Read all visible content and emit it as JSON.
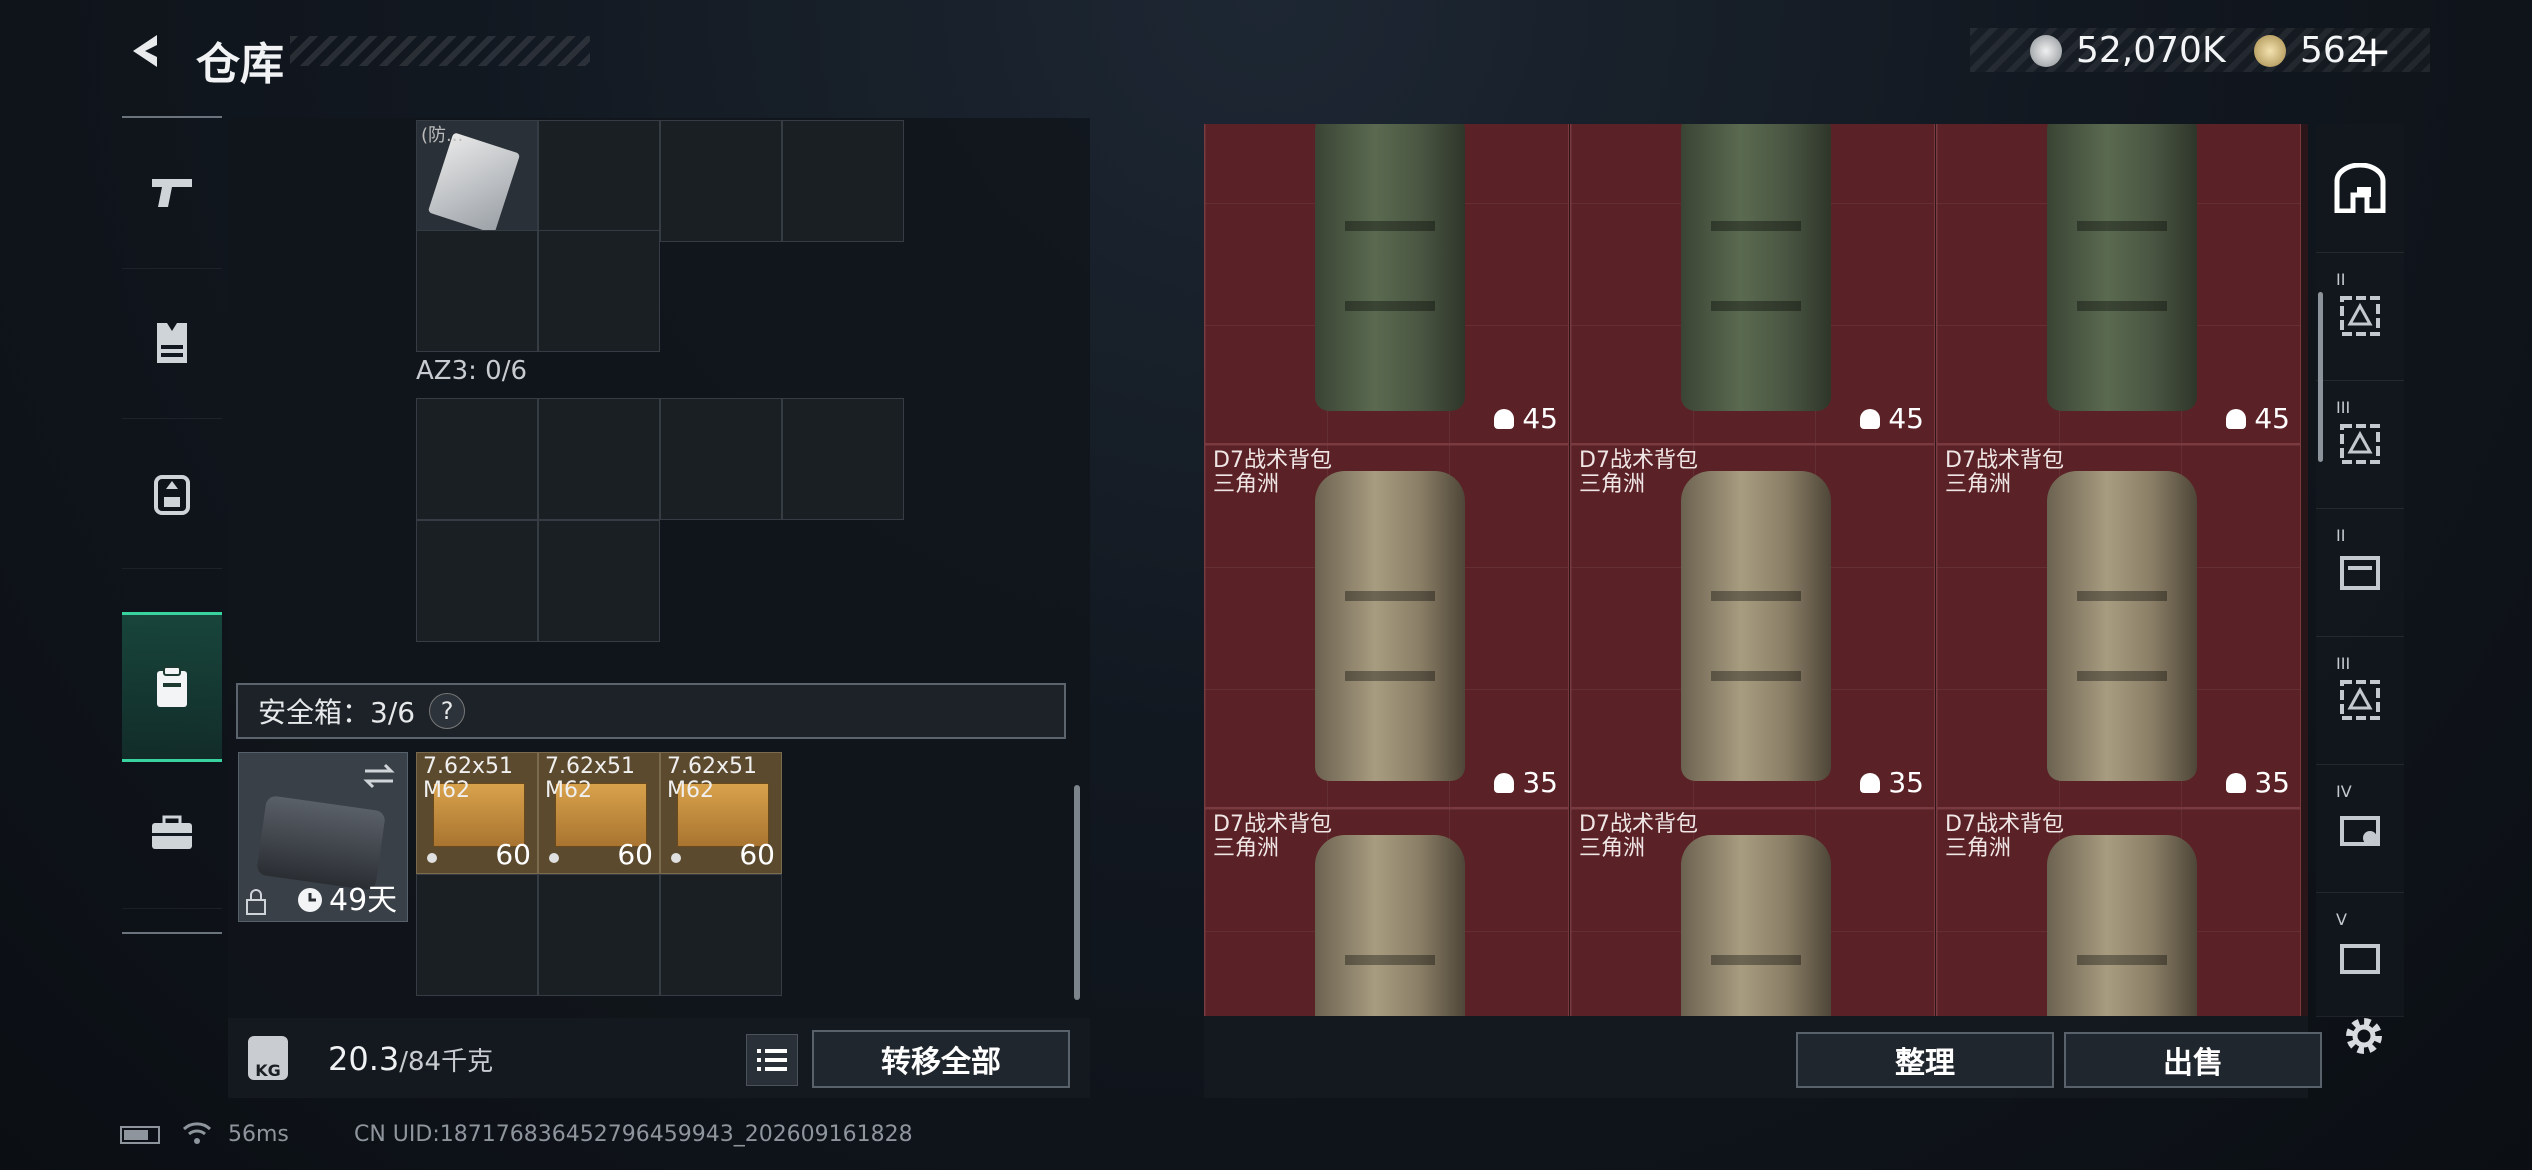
{
  "header": {
    "title": "仓库",
    "currency_a": "52,070K",
    "currency_b": "562",
    "currency_b_plus": "+"
  },
  "left_rail": {
    "items": [
      {
        "icon": "pistol-icon"
      },
      {
        "icon": "armor-vest-icon"
      },
      {
        "icon": "backpack-icon"
      },
      {
        "icon": "clipboard-icon"
      },
      {
        "icon": "toolbox-icon"
      }
    ]
  },
  "left_panel": {
    "top_item_label": "(防...",
    "az3_label": "AZ3: 0/6",
    "safe_label": "安全箱：3/6",
    "safe_help": "?",
    "case_days": "49天",
    "ammo": [
      {
        "name": "7.62x51\nM62",
        "count": "60"
      },
      {
        "name": "7.62x51\nM62",
        "count": "60"
      },
      {
        "name": "7.62x51\nM62",
        "count": "60"
      }
    ]
  },
  "weight": {
    "kg_icon": "KG",
    "current": "20.3",
    "max": "/84千克"
  },
  "buttons": {
    "transfer_all": "转移全部",
    "organize": "整理",
    "sell": "出售"
  },
  "status_bar": {
    "ping": "56ms",
    "uid": "CN UID:18717683645279645994​3_202609161828"
  },
  "right_grid": {
    "rows": [
      [
        {
          "name": "",
          "sub": "",
          "value": "45",
          "style": "green"
        },
        {
          "name": "",
          "sub": "",
          "value": "45",
          "style": "green"
        },
        {
          "name": "",
          "sub": "",
          "value": "45",
          "style": "green"
        }
      ],
      [
        {
          "name": "D7战术背包",
          "sub": "三角洲",
          "value": "35",
          "style": "tan"
        },
        {
          "name": "D7战术背包",
          "sub": "三角洲",
          "value": "35",
          "style": "tan"
        },
        {
          "name": "D7战术背包",
          "sub": "三角洲",
          "value": "35",
          "style": "tan"
        }
      ],
      [
        {
          "name": "D7战术背包",
          "sub": "三角洲",
          "value": "",
          "style": "tan"
        },
        {
          "name": "D7战术背包",
          "sub": "三角洲",
          "value": "",
          "style": "tan"
        },
        {
          "name": "D7战术背包",
          "sub": "三角洲",
          "value": "",
          "style": "tan"
        }
      ]
    ]
  },
  "right_tabs": [
    {
      "icon": "stash-icon",
      "sub": ""
    },
    {
      "icon": "case-level-icon",
      "sub": "II"
    },
    {
      "icon": "case-level-icon",
      "sub": "III"
    },
    {
      "icon": "case-level-icon",
      "sub": "II"
    },
    {
      "icon": "case-level-icon",
      "sub": "III"
    },
    {
      "icon": "case-level-icon",
      "sub": "IV"
    },
    {
      "icon": "case-level-icon",
      "sub": "V"
    }
  ],
  "colors": {
    "accent_green": "#39d3a0",
    "grid_red": "#5a2226"
  }
}
